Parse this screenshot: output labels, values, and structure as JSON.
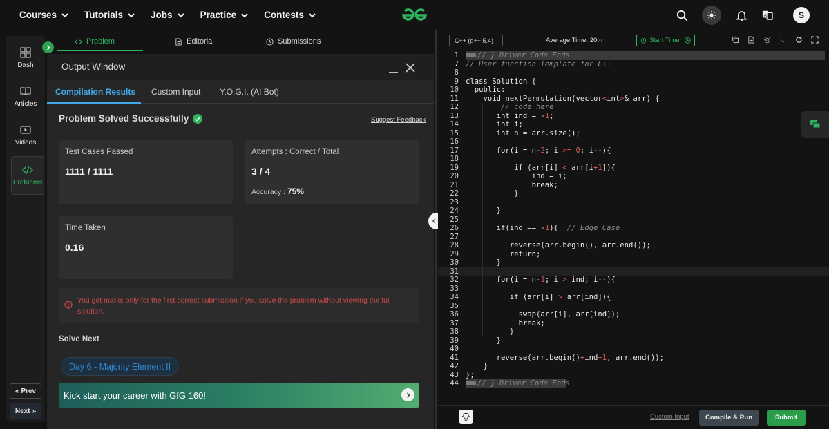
{
  "nav": {
    "links": [
      "Courses",
      "Tutorials",
      "Jobs",
      "Practice",
      "Contests"
    ],
    "avatar_initial": "S"
  },
  "rail": {
    "items": [
      {
        "label": "Dash",
        "icon": "dashboard-icon"
      },
      {
        "label": "Articles",
        "icon": "book-icon"
      },
      {
        "label": "Videos",
        "icon": "video-icon"
      },
      {
        "label": "Problems",
        "icon": "code-icon"
      }
    ],
    "prev_label": "Prev",
    "next_label": "Next"
  },
  "panel_tabs": [
    "Problem",
    "Editorial",
    "Submissions"
  ],
  "output": {
    "title": "Output Window",
    "tabs": [
      "Compilation Results",
      "Custom Input",
      "Y.O.G.I. (AI Bot)"
    ],
    "status": "Problem Solved Successfully",
    "feedback_link": "Suggest Feedback",
    "test_cases_label": "Test Cases Passed",
    "test_cases_value": "1111 / 1111",
    "attempts_label": "Attempts : Correct / Total",
    "attempts_value": "3 / 4",
    "accuracy_label": "Accuracy :",
    "accuracy_value": "75%",
    "time_label": "Time Taken",
    "time_value": "0.16",
    "warning": "You get marks only for the first correct submission if you solve the problem without viewing the full solution.",
    "solve_next_label": "Solve Next",
    "next_problem": "Day 6 - Majority Element II",
    "banner": "Kick start your career with GfG 160!"
  },
  "editor": {
    "language": "C++ (g++ 5.4)",
    "avg_time": "Average Time: 20m",
    "timer_label": "Start Timer",
    "line_numbers": [
      "1",
      "7",
      "8",
      "9",
      "10",
      "11",
      "12",
      "13",
      "14",
      "15",
      "16",
      "17",
      "18",
      "19",
      "20",
      "21",
      "22",
      "23",
      "24",
      "25",
      "26",
      "27",
      "28",
      "29",
      "30",
      "31",
      "32",
      "33",
      "34",
      "35",
      "36",
      "37",
      "38",
      "39",
      "40",
      "41",
      "42",
      "43",
      "44"
    ],
    "custom_input": "Custom Input",
    "compile_label": "Compile & Run",
    "submit_label": "Submit"
  },
  "colors": {
    "accent_green": "#2fb35f",
    "accent_blue": "#41a8e8",
    "warning_red": "#c94a4a"
  }
}
